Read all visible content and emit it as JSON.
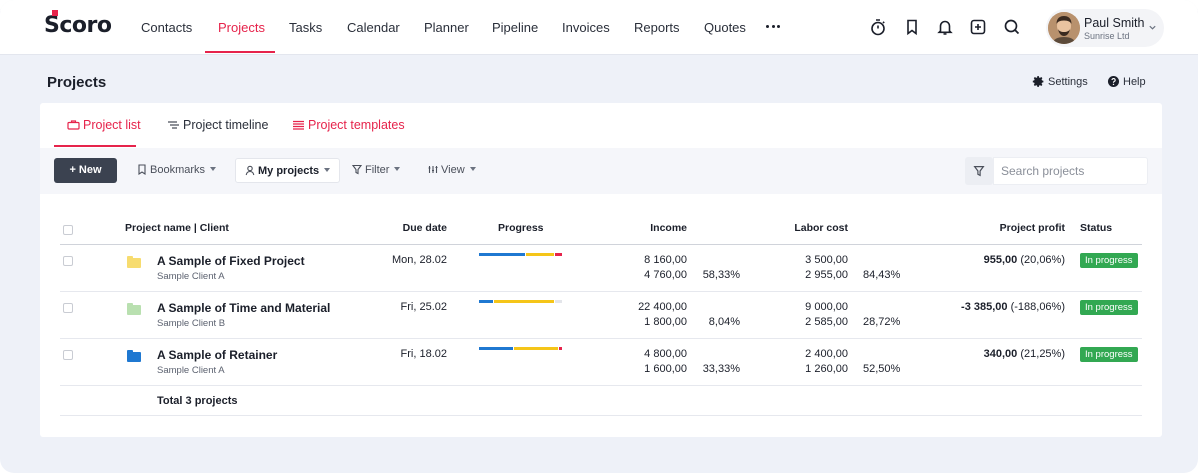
{
  "app": {
    "logo": "Scoro",
    "nav": [
      {
        "label": "Contacts"
      },
      {
        "label": "Projects",
        "active": true
      },
      {
        "label": "Tasks"
      },
      {
        "label": "Calendar"
      },
      {
        "label": "Planner"
      },
      {
        "label": "Pipeline"
      },
      {
        "label": "Invoices"
      },
      {
        "label": "Reports"
      },
      {
        "label": "Quotes"
      }
    ],
    "icons": [
      "stopwatch-icon",
      "bookmark-icon",
      "bell-icon",
      "add-square-icon",
      "search-icon"
    ],
    "user": {
      "name": "Paul Smith",
      "company": "Sunrise Ltd"
    }
  },
  "page": {
    "title": "Projects",
    "settings_label": "Settings",
    "help_label": "Help"
  },
  "tabs": [
    {
      "label": "Project list",
      "active": true
    },
    {
      "label": "Project timeline"
    },
    {
      "label": "Project templates"
    }
  ],
  "toolbar": {
    "new_label": "+ New",
    "bookmarks_label": "Bookmarks",
    "my_projects_label": "My projects",
    "filter_label": "Filter",
    "view_label": "View",
    "search_placeholder": "Search projects"
  },
  "table": {
    "headers": {
      "name": "Project name | Client",
      "due": "Due date",
      "progress": "Progress",
      "income": "Income",
      "labor": "Labor cost",
      "profit": "Project profit",
      "status": "Status"
    },
    "rows": [
      {
        "name": "A Sample of Fixed Project",
        "client": "Sample Client A",
        "due": "Mon, 28.02",
        "folder_color": "#f7dc6f",
        "progress": {
          "blue": 0.55,
          "yellow": 0.35,
          "red": 0.1,
          "grey": 0.0
        },
        "income_1": "8 160,00",
        "income_2": "4 760,00",
        "income_pct": "58,33%",
        "labor_1": "3 500,00",
        "labor_2": "2 955,00",
        "labor_pct": "84,43%",
        "profit": "955,00",
        "profit_pct": "(20,06%)",
        "status": "In progress"
      },
      {
        "name": "A Sample of Time and Material",
        "client": "Sample Client B",
        "due": "Fri, 25.02",
        "folder_color": "#b9e0b0",
        "progress": {
          "blue": 0.17,
          "yellow": 0.73,
          "red": 0.0,
          "grey": 0.1
        },
        "income_1": "22 400,00",
        "income_2": "1 800,00",
        "income_pct": "8,04%",
        "labor_1": "9 000,00",
        "labor_2": "2 585,00",
        "labor_pct": "28,72%",
        "profit": "-3 385,00",
        "profit_pct": "(-188,06%)",
        "status": "In progress"
      },
      {
        "name": "A Sample of Retainer",
        "client": "Sample Client A",
        "due": "Fri, 18.02",
        "folder_color": "#1f78d1",
        "progress": {
          "blue": 0.41,
          "yellow": 0.54,
          "red": 0.05,
          "grey": 0.0
        },
        "income_1": "4 800,00",
        "income_2": "1 600,00",
        "income_pct": "33,33%",
        "labor_1": "2 400,00",
        "labor_2": "1 260,00",
        "labor_pct": "52,50%",
        "profit": "340,00",
        "profit_pct": "(21,25%)",
        "status": "In progress"
      }
    ],
    "total_label": "Total 3 projects"
  },
  "colors": {
    "accent": "#e6234b",
    "status_green": "#32a852",
    "progress_blue": "#1f78d1",
    "progress_yellow": "#f5c518",
    "progress_red": "#e6234b",
    "progress_grey": "#e3e5ea"
  }
}
